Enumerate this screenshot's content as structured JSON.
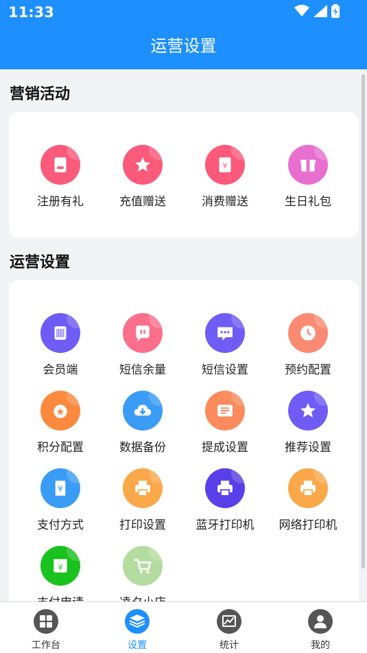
{
  "status": {
    "time": "11:33"
  },
  "header": {
    "title": "运营设置"
  },
  "marketing": {
    "title": "营销活动",
    "items": [
      {
        "label": "注册有礼",
        "icon": "gift-card-icon",
        "color": "#fb5a7a"
      },
      {
        "label": "充值赠送",
        "icon": "star-badge-icon",
        "color": "#fb5a7a"
      },
      {
        "label": "消费赠送",
        "icon": "coupon-icon",
        "color": "#fb5a7a"
      },
      {
        "label": "生日礼包",
        "icon": "gift-box-icon",
        "color": "#e86fd0"
      }
    ]
  },
  "operations": {
    "title": "运营设置",
    "items": [
      {
        "label": "会员端",
        "icon": "barcode-scan-icon",
        "color": "#6f5cf5"
      },
      {
        "label": "短信余量",
        "icon": "chat-bubble-icon",
        "color": "#fb6f8a"
      },
      {
        "label": "短信设置",
        "icon": "message-dots-icon",
        "color": "#6f5cf5"
      },
      {
        "label": "预约配置",
        "icon": "clock-icon",
        "color": "#fb8a73"
      },
      {
        "label": "积分配置",
        "icon": "medal-icon",
        "color": "#fb8a3e"
      },
      {
        "label": "数据备份",
        "icon": "cloud-download-icon",
        "color": "#3b9cf6"
      },
      {
        "label": "提成设置",
        "icon": "list-card-icon",
        "color": "#fb8a5c"
      },
      {
        "label": "推荐设置",
        "icon": "star-icon",
        "color": "#6f5cf5"
      },
      {
        "label": "支付方式",
        "icon": "yuan-receipt-icon",
        "color": "#3b9cf6"
      },
      {
        "label": "打印设置",
        "icon": "printer-icon",
        "color": "#fba84a"
      },
      {
        "label": "蓝牙打印机",
        "icon": "bluetooth-printer-icon",
        "color": "#5a40e8"
      },
      {
        "label": "网络打印机",
        "icon": "network-printer-icon",
        "color": "#fba84a"
      },
      {
        "label": "支付申请",
        "icon": "yuan-wallet-icon",
        "color": "#19c21c"
      },
      {
        "label": "凌夕小店",
        "icon": "shopping-cart-icon",
        "color": "#b5dca0"
      }
    ]
  },
  "tabbar": {
    "active_color": "#1e8ffe",
    "inactive_color": "#555555",
    "items": [
      {
        "label": "工作台",
        "icon": "grid-icon",
        "active": false
      },
      {
        "label": "设置",
        "icon": "layers-icon",
        "active": true
      },
      {
        "label": "统计",
        "icon": "chart-icon",
        "active": false
      },
      {
        "label": "我的",
        "icon": "user-icon",
        "active": false
      }
    ]
  }
}
